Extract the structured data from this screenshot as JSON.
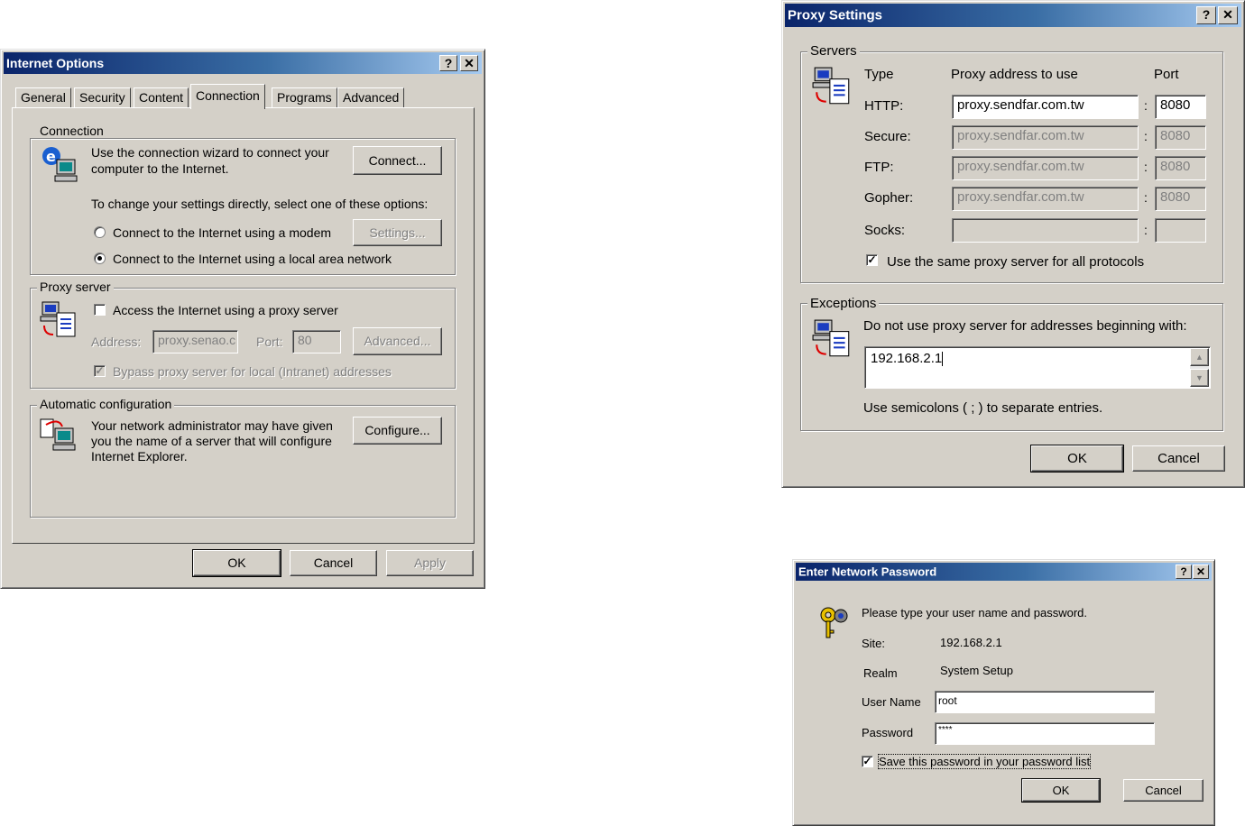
{
  "internet_options": {
    "title": "Internet Options",
    "help_btn": "?",
    "close_btn": "✕",
    "tabs": [
      "General",
      "Security",
      "Content",
      "Connection",
      "Programs",
      "Advanced"
    ],
    "active_tab": "Connection",
    "connection": {
      "legend": "Connection",
      "wizard_text_1": "Use the connection wizard to connect your",
      "wizard_text_2": "computer to the Internet.",
      "connect_btn": "Connect...",
      "change_text": "To change your settings directly, select one of these options:",
      "modem_option": "Connect to the Internet using a modem",
      "settings_btn": "Settings...",
      "lan_option": "Connect to the Internet using a local area network"
    },
    "proxy": {
      "legend": "Proxy server",
      "access_label": "Access the Internet using a proxy server",
      "address_label": "Address:",
      "address_value": "proxy.senao.c",
      "port_label": "Port:",
      "port_value": "80",
      "advanced_btn": "Advanced...",
      "bypass_label": "Bypass proxy server for local (Intranet) addresses"
    },
    "auto": {
      "legend": "Automatic configuration",
      "text_1": "Your network administrator may have given",
      "text_2": "you the name of a server that will configure",
      "text_3": "Internet Explorer.",
      "configure_btn": "Configure..."
    },
    "ok": "OK",
    "cancel": "Cancel",
    "apply": "Apply"
  },
  "proxy_settings": {
    "title": "Proxy Settings",
    "help_btn": "?",
    "close_btn": "✕",
    "servers_legend": "Servers",
    "col_type": "Type",
    "col_address": "Proxy address to use",
    "col_port": "Port",
    "rows": [
      {
        "label": "HTTP:",
        "address": "proxy.sendfar.com.tw",
        "port": "8080",
        "enabled": true
      },
      {
        "label": "Secure:",
        "address": "proxy.sendfar.com.tw",
        "port": "8080",
        "enabled": false
      },
      {
        "label": "FTP:",
        "address": "proxy.sendfar.com.tw",
        "port": "8080",
        "enabled": false
      },
      {
        "label": "Gopher:",
        "address": "proxy.sendfar.com.tw",
        "port": "8080",
        "enabled": false
      },
      {
        "label": "Socks:",
        "address": "",
        "port": "",
        "enabled": false
      }
    ],
    "colon": ":",
    "same_proxy_label": "Use the same proxy server for all protocols",
    "exceptions_legend": "Exceptions",
    "exceptions_text": "Do not use proxy server for addresses beginning with:",
    "exceptions_value": "192.168.2.1",
    "semicolon_text": "Use semicolons ( ; ) to separate entries.",
    "ok": "OK",
    "cancel": "Cancel"
  },
  "net_password": {
    "title": "Enter Network Password",
    "help_btn": "?",
    "close_btn": "✕",
    "prompt": "Please type your user name and password.",
    "site_label": "Site:",
    "site_value": "192.168.2.1",
    "realm_label": "Realm",
    "realm_value": "System Setup",
    "username_label": "User Name",
    "username_value": "root",
    "password_label": "Password",
    "password_value": "****",
    "save_label": "Save this password in your password list",
    "ok": "OK",
    "cancel": "Cancel"
  }
}
